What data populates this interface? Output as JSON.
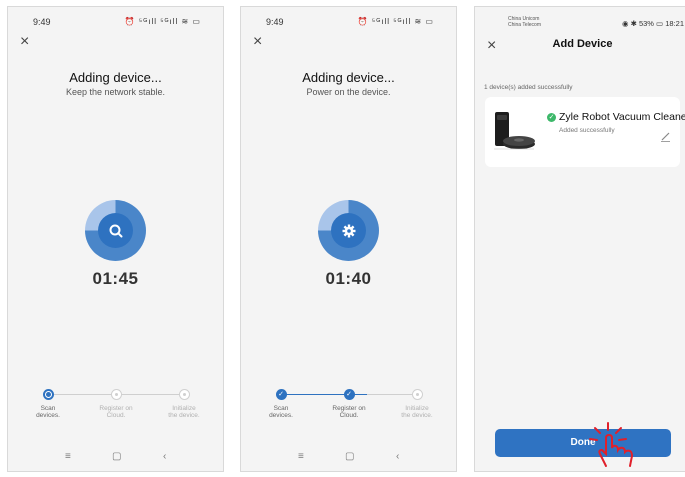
{
  "panel1": {
    "time": "9:49",
    "status_icons": "⏰ ⁵ᴳıll ⁵ᴳıll ≋ ▭",
    "close_label": "×",
    "title": "Adding device...",
    "subtitle": "Keep the network stable.",
    "center_icon": "search-icon",
    "timer": "01:45",
    "steps": [
      {
        "label": "Scan\ndevices.",
        "state": "active"
      },
      {
        "label": "Register on\nCloud.",
        "state": "pending"
      },
      {
        "label": "Initialize\nthe device.",
        "state": "pending"
      }
    ]
  },
  "panel2": {
    "time": "9:49",
    "status_icons": "⏰ ⁵ᴳıll ⁵ᴳıll ≋ ▭",
    "close_label": "×",
    "title": "Adding device...",
    "subtitle": "Power on the device.",
    "center_icon": "gear-icon",
    "timer": "01:40",
    "steps": [
      {
        "label": "Scan\ndevices.",
        "state": "done"
      },
      {
        "label": "Register on\nCloud.",
        "state": "done"
      },
      {
        "label": "Initialize\nthe device.",
        "state": "pending"
      }
    ]
  },
  "panel3": {
    "carrier1": "China Unicom",
    "carrier2": "China Telecom",
    "status_right": "◉ ✱ 53% ▭ 18:21",
    "close_label": "×",
    "title": "Add Device",
    "message": "1 device(s) added successfully",
    "device_name": "Zyle Robot Vacuum Cleaner",
    "device_status": "Added successfully",
    "done_label": "Done"
  },
  "nav": {
    "recent": "≡",
    "home": "▢",
    "back": "‹"
  },
  "colors": {
    "accent": "#2e72c0",
    "ring_light": "#a9c5ea",
    "success": "#3db86a",
    "hand": "#e0202b"
  }
}
